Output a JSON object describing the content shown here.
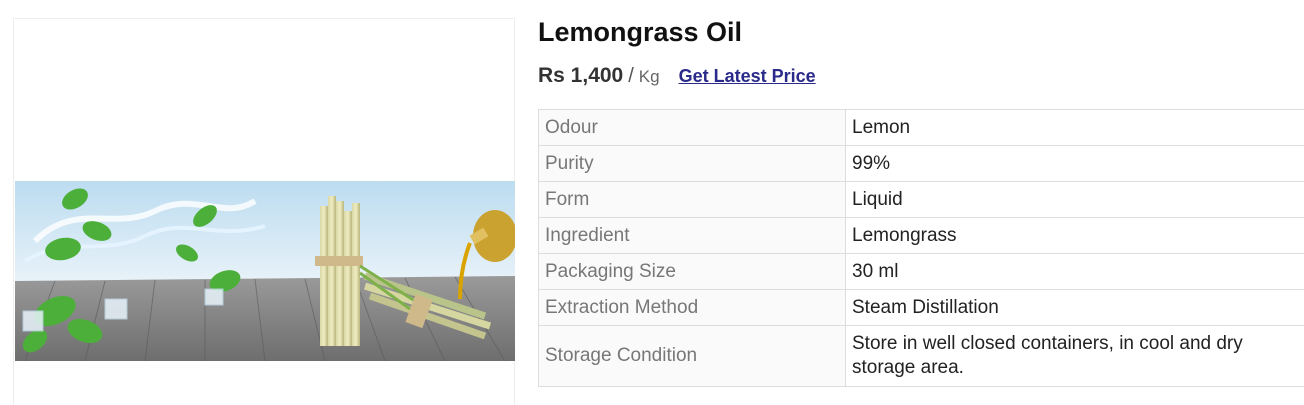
{
  "product": {
    "title": "Lemongrass Oil",
    "image_icon": "lemongrass-product-photo",
    "price": {
      "amount": "Rs 1,400",
      "separator": "/",
      "unit": "Kg",
      "cta_label": "Get Latest Price"
    },
    "specs": [
      {
        "key": "Odour",
        "value": "Lemon"
      },
      {
        "key": "Purity",
        "value": "99%"
      },
      {
        "key": "Form",
        "value": "Liquid"
      },
      {
        "key": "Ingredient",
        "value": "Lemongrass"
      },
      {
        "key": "Packaging Size",
        "value": "30 ml"
      },
      {
        "key": "Extraction Method",
        "value": "Steam Distillation"
      },
      {
        "key": "Storage Condition",
        "value": "Store in well closed containers, in cool and dry storage area."
      }
    ]
  },
  "colors": {
    "link": "#2a2a8a",
    "sky": "#cfe6f5",
    "floor": "#8a8a8a",
    "lemongrass": "#c9c98a",
    "leaf": "#4caf3a",
    "oil": "#d9a400"
  }
}
